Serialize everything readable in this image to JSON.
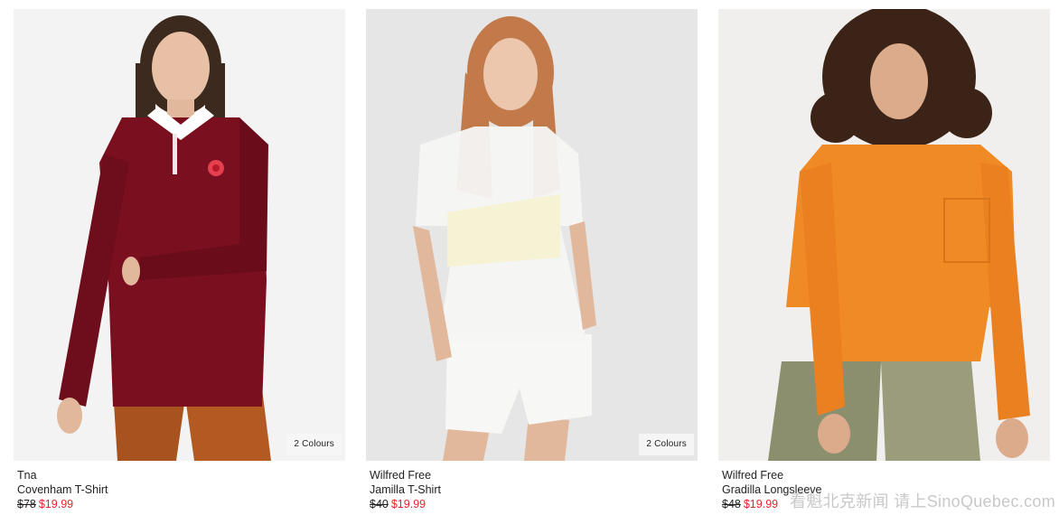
{
  "products": [
    {
      "brand": "Tna",
      "name": "Covenham T-Shirt",
      "original_price": "$78",
      "sale_price": "$19.99",
      "colours_badge": "2 Colours",
      "garment_color": "#7a0f1f",
      "image_alt": "Model wearing maroon rugby long-sleeve"
    },
    {
      "brand": "Wilfred Free",
      "name": "Jamilla T-Shirt",
      "original_price": "$40",
      "sale_price": "$19.99",
      "colours_badge": "2 Colours",
      "garment_color": "#f4f4f2",
      "image_alt": "Model wearing sheer white t-shirt"
    },
    {
      "brand": "Wilfred Free",
      "name": "Gradilla Longsleeve",
      "original_price": "$48",
      "sale_price": "$19.99",
      "colours_badge": "",
      "garment_color": "#f08a24",
      "image_alt": "Model wearing orange long-sleeve"
    }
  ],
  "watermark": "看魁北克新闻 请上SinoQuebec.com",
  "colors": {
    "sale": "#e4252c",
    "photo_bg_light": "#f3f3f3",
    "photo_bg_grey": "#e6e6e6"
  }
}
